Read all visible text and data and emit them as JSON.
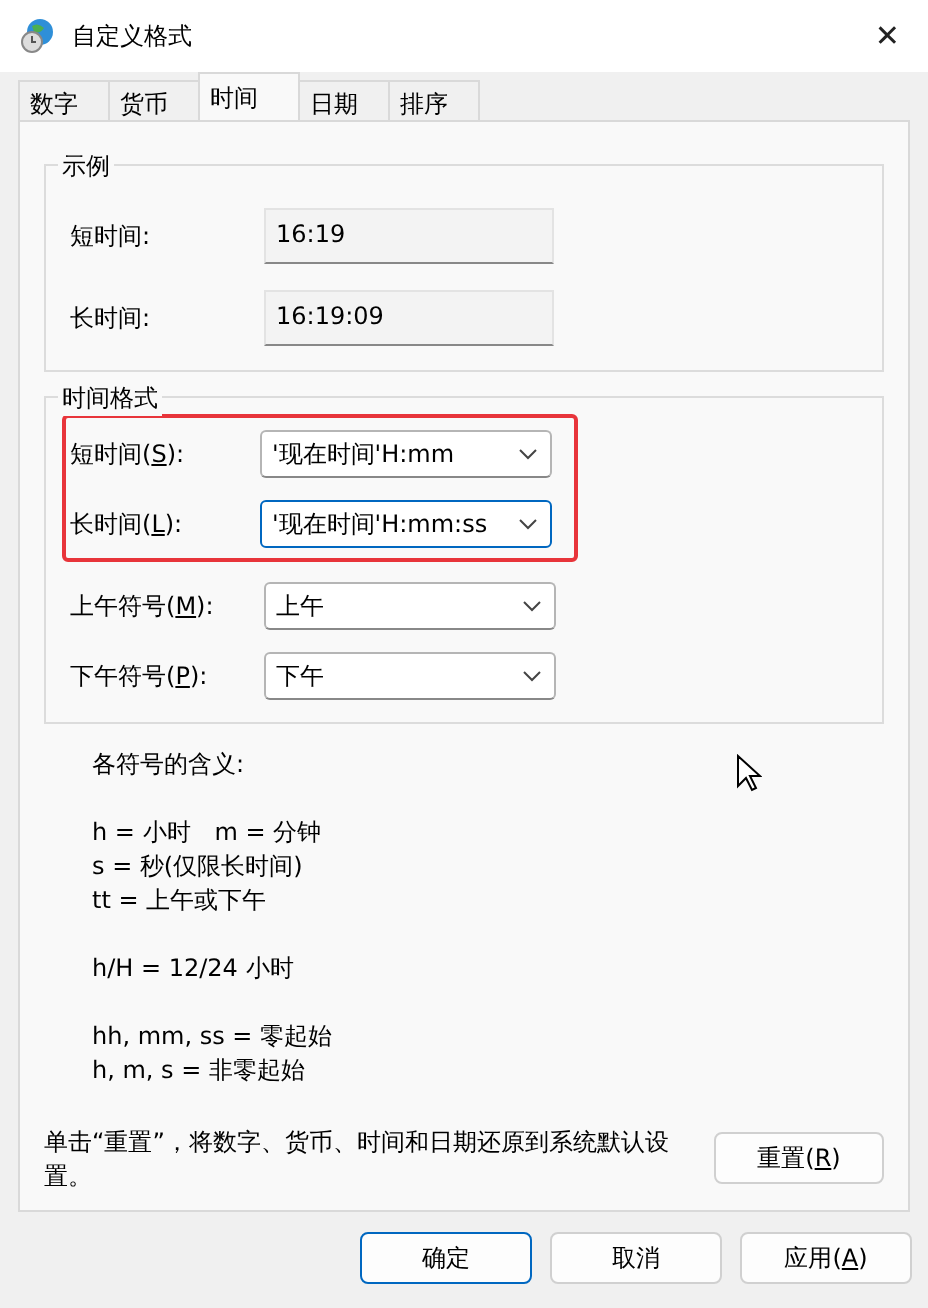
{
  "window": {
    "title": "自定义格式",
    "close": "✕"
  },
  "tabs": [
    {
      "label": "数字",
      "selected": false
    },
    {
      "label": "货币",
      "selected": false
    },
    {
      "label": "时间",
      "selected": true
    },
    {
      "label": "日期",
      "selected": false
    },
    {
      "label": "排序",
      "selected": false
    }
  ],
  "example": {
    "title": "示例",
    "rows": [
      {
        "label": "短时间:",
        "value": "16:19"
      },
      {
        "label": "长时间:",
        "value": "16:19:09"
      }
    ]
  },
  "time_format": {
    "title": "时间格式",
    "rows": [
      {
        "label_before": "短时间(",
        "mnemonic": "S",
        "label_after": "):",
        "value": "'现在时间'H:mm",
        "focused": false,
        "highlighted": true
      },
      {
        "label_before": "长时间(",
        "mnemonic": "L",
        "label_after": "):",
        "value": "'现在时间'H:mm:ss",
        "focused": true,
        "highlighted": true
      },
      {
        "label_before": "上午符号(",
        "mnemonic": "M",
        "label_after": "):",
        "value": "上午",
        "focused": false,
        "highlighted": false
      },
      {
        "label_before": "下午符号(",
        "mnemonic": "P",
        "label_after": "):",
        "value": "下午",
        "focused": false,
        "highlighted": false
      }
    ]
  },
  "legend": {
    "title": "各符号的含义:",
    "groups": [
      [
        "h = 小时　m = 分钟",
        "s = 秒(仅限长时间)",
        "tt = 上午或下午"
      ],
      [
        "h/H = 12/24 小时"
      ],
      [
        "hh, mm, ss = 零起始",
        "h, m, s = 非零起始"
      ]
    ]
  },
  "reset": {
    "text": "单击“重置”，将数字、货币、时间和日期还原到系统默认设置。",
    "button_before": "重置(",
    "button_mnemonic": "R",
    "button_after": ")"
  },
  "buttons": [
    {
      "label_before": "确定",
      "default": true
    },
    {
      "label_before": "取消",
      "default": false
    },
    {
      "label_before": "应用(",
      "mnemonic": "A",
      "label_after": ")",
      "default": false
    }
  ]
}
